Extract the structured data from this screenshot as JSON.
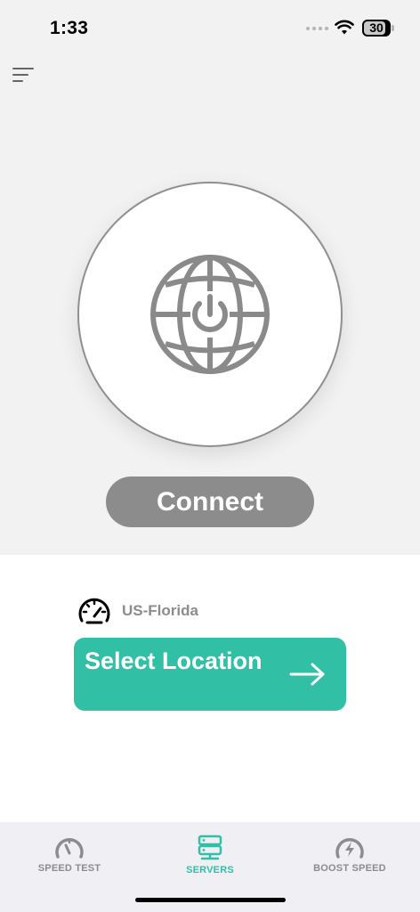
{
  "status_bar": {
    "time": "1:33",
    "battery_text": "30",
    "signal_icon": "cellular-dots-icon",
    "wifi_icon": "wifi-icon",
    "battery_icon": "battery-icon"
  },
  "header": {
    "menu_icon": "hamburger-menu-icon"
  },
  "main": {
    "power_icon": "globe-power-icon",
    "connect_label": "Connect",
    "server_icon": "speedometer-icon",
    "server_name": "US-Florida",
    "select_location_label": "Select Location",
    "select_location_icon": "arrow-right-icon"
  },
  "tab_bar": {
    "items": [
      {
        "label": "SPEED TEST",
        "icon": "gauge-icon",
        "active": false
      },
      {
        "label": "SERVERS",
        "icon": "server-stack-icon",
        "active": true
      },
      {
        "label": "BOOST SPEED",
        "icon": "bolt-gauge-icon",
        "active": false
      }
    ]
  },
  "colors": {
    "accent": "#31bfa6",
    "connect_button": "#8c8c8c",
    "hero_background": "#f2f2f2",
    "icon_gray": "#8a8a8a"
  }
}
